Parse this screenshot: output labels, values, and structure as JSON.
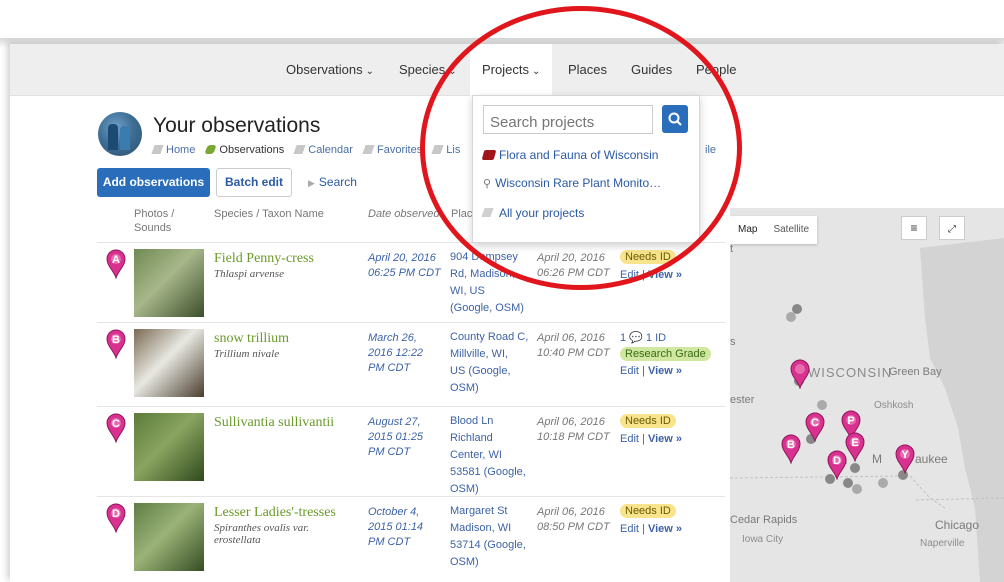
{
  "nav": {
    "items": [
      {
        "label": "Observations",
        "caret": "⌄"
      },
      {
        "label": "Species",
        "caret": "⌄"
      },
      {
        "label": "Projects",
        "caret": "⌄"
      },
      {
        "label": "Places"
      },
      {
        "label": "Guides"
      },
      {
        "label": "People"
      }
    ]
  },
  "header": {
    "title": "Your observations",
    "subnav": [
      "Home",
      "Observations",
      "Calendar",
      "Favorites",
      "Lis",
      "ile"
    ]
  },
  "toolbar": {
    "add_label": "Add observations",
    "batch_label": "Batch edit",
    "search_label": "Search"
  },
  "table": {
    "headers": {
      "photos": "Photos /",
      "sounds": "Sounds",
      "species": "Species / Taxon Name",
      "date": "Date observed",
      "place": "Plac"
    },
    "rows": [
      {
        "marker": "A",
        "common": "Field Penny-cress",
        "sci": "Thlaspi arvense",
        "date": [
          "April 20, 2016",
          "06:25 PM CDT"
        ],
        "place": [
          "904 Dempsey",
          "Rd, Madison,",
          "WI, US",
          "(Google, OSM)"
        ],
        "added": [
          "April 20, 2016",
          "06:26 PM CDT"
        ],
        "id_line": "",
        "badge": "Needs ID",
        "badge_type": "needs",
        "edit": "Edit",
        "view": "View »"
      },
      {
        "marker": "B",
        "common": "snow trillium",
        "sci": "Trillium nivale",
        "date": [
          "March 26,",
          "2016 12:22",
          "PM CDT"
        ],
        "place": [
          "County Road C,",
          "Millville, WI,",
          "US (Google,",
          "OSM)"
        ],
        "added": [
          "April 06, 2016",
          "10:40 PM CDT"
        ],
        "id_line": "1 💬 1 ID",
        "badge": "Research Grade",
        "badge_type": "rg",
        "edit": "Edit",
        "view": "View »"
      },
      {
        "marker": "C",
        "common": "Sullivantia sullivantii",
        "sci": "",
        "date": [
          "August 27,",
          "2015 01:25",
          "PM CDT"
        ],
        "place": [
          "Blood Ln",
          "Richland",
          "Center, WI",
          "53581 (Google,",
          "OSM)"
        ],
        "added": [
          "April 06, 2016",
          "10:18 PM CDT"
        ],
        "id_line": "",
        "badge": "Needs ID",
        "badge_type": "needs",
        "edit": "Edit",
        "view": "View »"
      },
      {
        "marker": "D",
        "common": "Lesser Ladies'-tresses",
        "sci": "Spiranthes ovalis var.\nerostellata",
        "date": [
          "October 4,",
          "2015 01:14",
          "PM CDT"
        ],
        "place": [
          "Margaret St",
          "Madison, WI",
          "53714 (Google,",
          "OSM)"
        ],
        "added": [
          "April 06, 2016",
          "08:50 PM CDT"
        ],
        "id_line": "",
        "badge": "Needs ID",
        "badge_type": "needs",
        "edit": "Edit",
        "view": "View »"
      }
    ]
  },
  "projects_dropdown": {
    "search_placeholder": "Search projects",
    "items": [
      {
        "label": "Flora and Fauna of Wisconsin",
        "icon": "project-logo-icon"
      },
      {
        "label": "Wisconsin Rare Plant Monito…",
        "icon": "magnifier-icon"
      },
      {
        "label": "All your projects",
        "icon": "project-icon"
      }
    ]
  },
  "map": {
    "tab_map": "Map",
    "tab_satellite": "Satellite",
    "labels": {
      "wisconsin": "WISCONSIN",
      "green_bay": "Green Bay",
      "oshkosh": "Oshkosh",
      "ester": "ester",
      "on": "on",
      "waukee": "aukee",
      "cedar_rapids": "Cedar Rapids",
      "iowa_city": "Iowa City",
      "chicago": "Chicago",
      "naperville": "Naperville",
      "s": "s",
      "m": "M",
      "t": "t"
    },
    "markers": [
      "B",
      "C",
      "P",
      "E",
      "D",
      "Y"
    ]
  },
  "colors": {
    "primary": "#2a6ebb",
    "marker_pink": "#d9318f",
    "highlight_circle": "#e1151c"
  }
}
